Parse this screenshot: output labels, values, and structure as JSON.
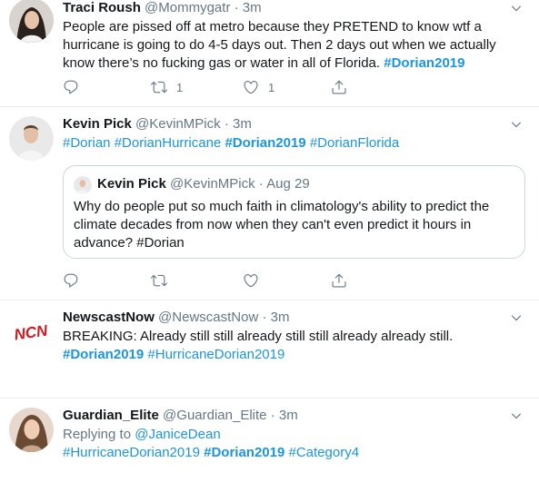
{
  "tweets": [
    {
      "name": "Traci Roush",
      "handle": "@Mommygatr",
      "sep": "·",
      "time": "3m",
      "text": "People are pissed off at metro because they PRETEND to know wtf a hurricane is going to do 4-5 days out. Then 2 days out when we actually know there’s no fucking gas or water in all of Florida.",
      "hashtag": "#Dorian2019",
      "retweets": "1",
      "likes": "1"
    },
    {
      "name": "Kevin Pick",
      "handle": "@KevinMPick",
      "sep": "·",
      "time": "3m",
      "tags": [
        "#Dorian",
        "#DorianHurricane",
        "#Dorian2019",
        "#DorianFlorida"
      ],
      "quote": {
        "name": "Kevin Pick",
        "handle": "@KevinMPick",
        "sep": "·",
        "time": "Aug 29",
        "text": "Why do people put so much faith in climatology's ability to predict the climate decades from now when they can't even predict it hours in advance? #Dorian"
      }
    },
    {
      "name": "NewscastNow",
      "handle": "@NewscastNow",
      "sep": "·",
      "time": "3m",
      "avatar_text": "NCN",
      "text": "BREAKING: Already still still already still still already already still.",
      "tags": [
        "#Dorian2019",
        "#HurricaneDorian2019"
      ]
    },
    {
      "name": "Guardian_Elite",
      "handle": "@Guardian_Elite",
      "sep": "·",
      "time": "3m",
      "reply_prefix": "Replying to",
      "reply_to": "@JaniceDean",
      "tags": [
        "#HurricaneDorian2019",
        "#Dorian2019",
        "#Category4"
      ]
    }
  ],
  "icons": [
    "reply-icon",
    "retweet-icon",
    "like-icon",
    "share-icon",
    "chevron-down-icon"
  ],
  "colors": {
    "link": "#1b95e0",
    "muted": "#657786",
    "text": "#14171a",
    "border": "#e6ecf0",
    "ncn_red": "#d71920"
  }
}
